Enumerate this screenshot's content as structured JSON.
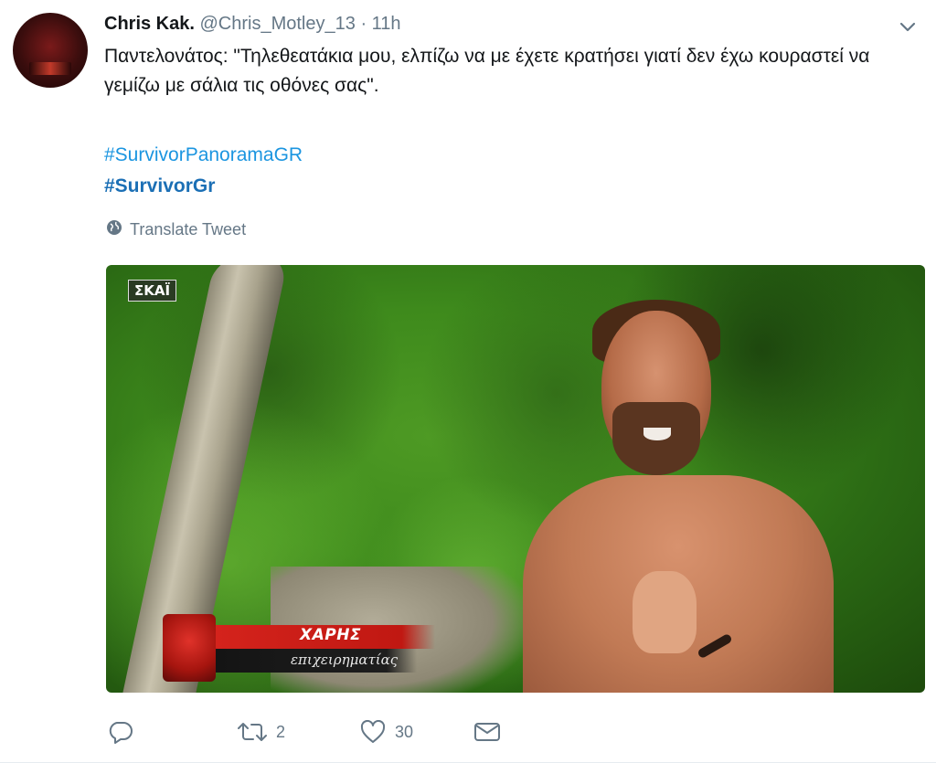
{
  "tweet": {
    "author_name": "Chris Kak.",
    "handle": "@Chris_Motley_13",
    "separator": "·",
    "time": "11h",
    "text": "Παντελονάτος: \"Τηλεθεατάκια μου, ελπίζω να με έχετε κρατήσει γιατί δεν έχω κουραστεί να γεμίζω με σάλια τις οθόνες σας\".",
    "hashtags": [
      "#SurvivorPanoramaGR",
      "#SurvivorGr"
    ],
    "translate_label": "Translate Tweet"
  },
  "media": {
    "channel_badge": "ΣΚΑΪ",
    "lower_third_name": "ΧΑΡΗΣ",
    "lower_third_role": "επιχειρηματίας"
  },
  "actions": {
    "reply_count": "",
    "retweet_count": "2",
    "like_count": "30"
  },
  "colors": {
    "link": "#1b95e0",
    "muted": "#657786",
    "text": "#14171a"
  },
  "icons": [
    "chevron-down-icon",
    "globe-icon",
    "reply-icon",
    "retweet-icon",
    "heart-icon",
    "envelope-icon"
  ]
}
